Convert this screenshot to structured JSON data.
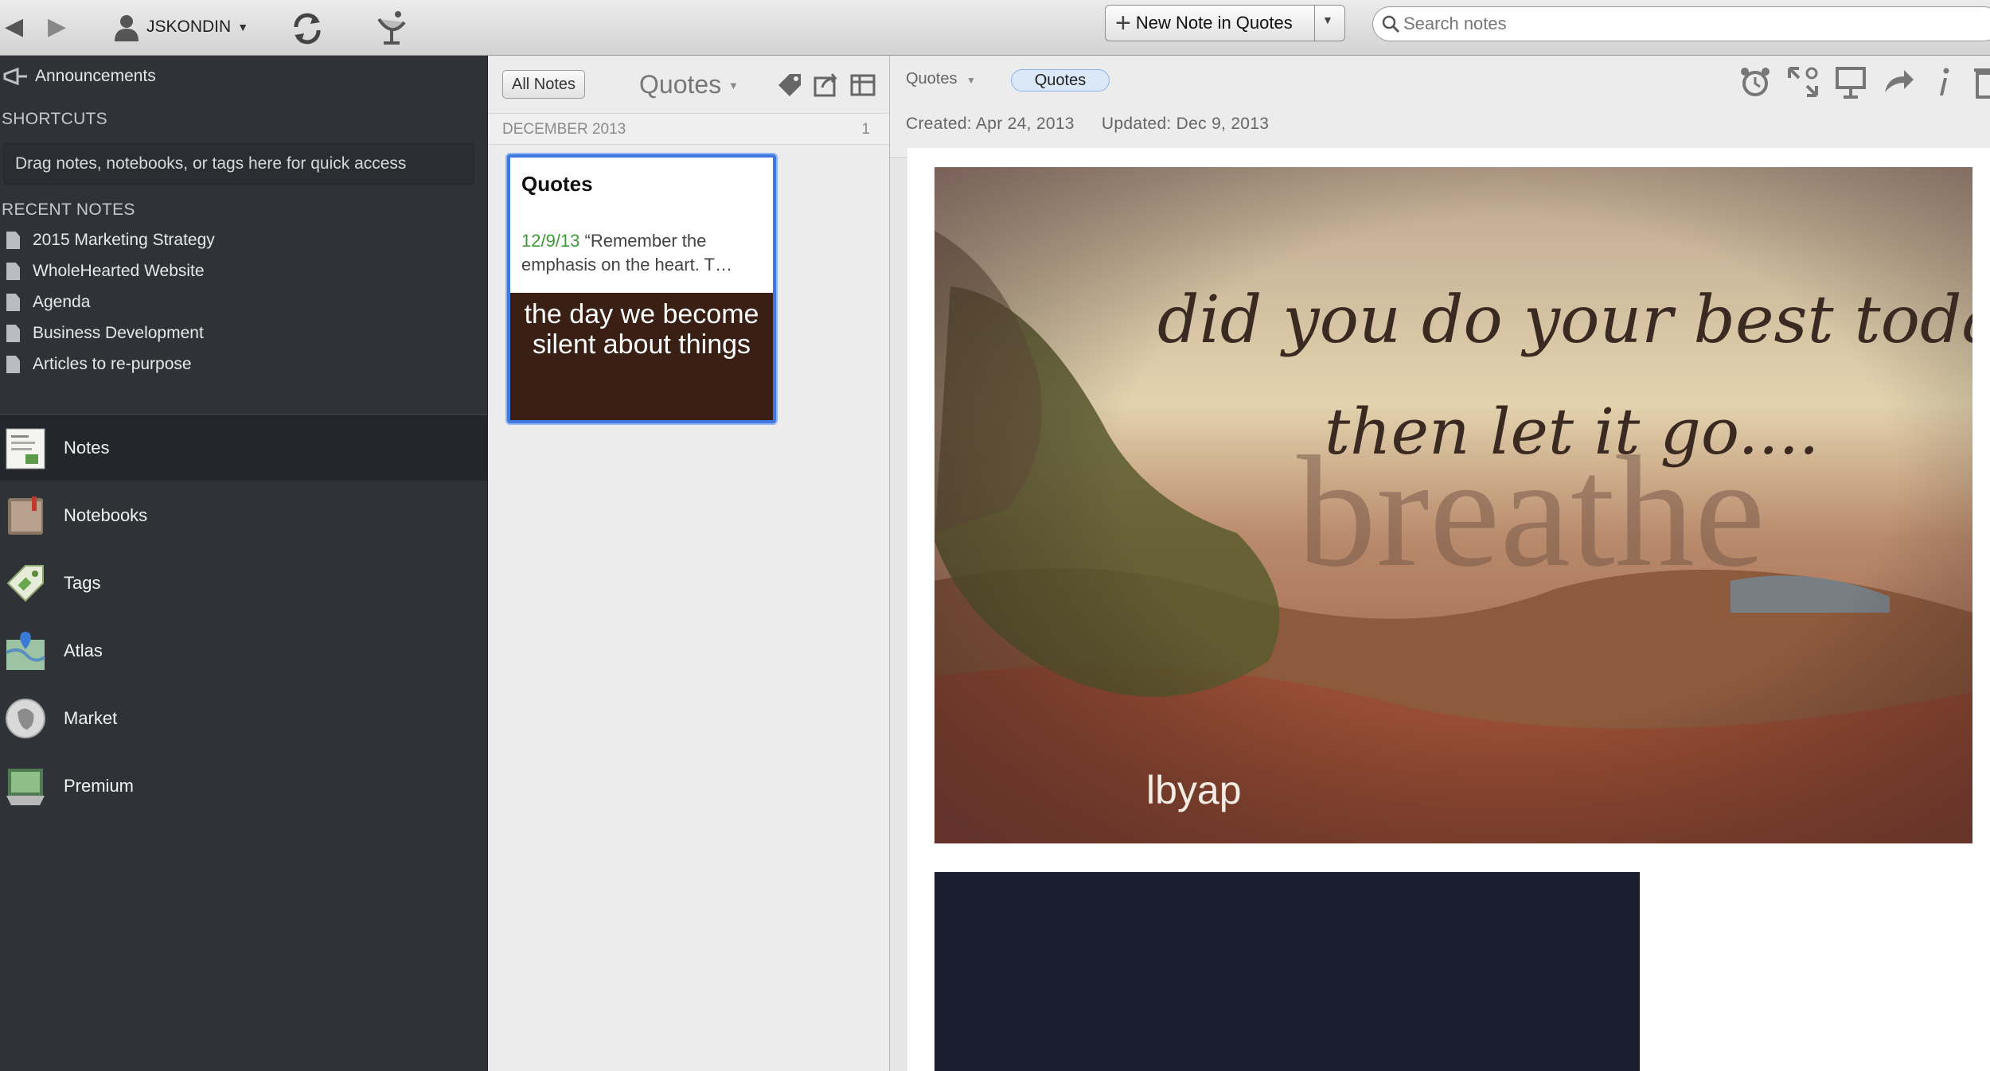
{
  "toolbar": {
    "username": "JSKONDIN",
    "new_note_label": "New Note in Quotes",
    "search_placeholder": "Search notes"
  },
  "sidebar": {
    "announcements": "Announcements",
    "shortcuts_heading": "SHORTCUTS",
    "shortcuts_hint": "Drag notes, notebooks, or tags here for quick access",
    "recent_heading": "RECENT NOTES",
    "recent_notes": [
      "2015 Marketing Strategy",
      "WholeHearted Website",
      "Agenda",
      "Business Development",
      "Articles to re-purpose"
    ],
    "nav": [
      {
        "label": "Notes",
        "icon": "notes-icon",
        "active": true
      },
      {
        "label": "Notebooks",
        "icon": "notebooks-icon",
        "active": false
      },
      {
        "label": "Tags",
        "icon": "tags-icon",
        "active": false
      },
      {
        "label": "Atlas",
        "icon": "atlas-icon",
        "active": false
      },
      {
        "label": "Market",
        "icon": "market-icon",
        "active": false
      },
      {
        "label": "Premium",
        "icon": "premium-icon",
        "active": false
      }
    ]
  },
  "notelist": {
    "all_notes_label": "All Notes",
    "title": "Quotes",
    "group_label": "DECEMBER 2013",
    "group_count": "1",
    "card": {
      "title": "Quotes",
      "date": "12/9/13",
      "snippet": "“Remember the emphasis on the heart. T…",
      "thumb_text": "the day we become silent about things"
    }
  },
  "editor": {
    "notebook": "Quotes",
    "tag": "Quotes",
    "created": "Created: Apr 24, 2013",
    "updated": "Updated: Dec 9, 2013",
    "image_text": {
      "line1": "did you do your best today?",
      "line2": "then let it go....",
      "line3": "breathe",
      "signature": "lbyap"
    }
  },
  "colors": {
    "sidebar_bg": "#2f3338",
    "selection_blue": "#3f78e0",
    "snippet_date_green": "#3d9b35"
  }
}
